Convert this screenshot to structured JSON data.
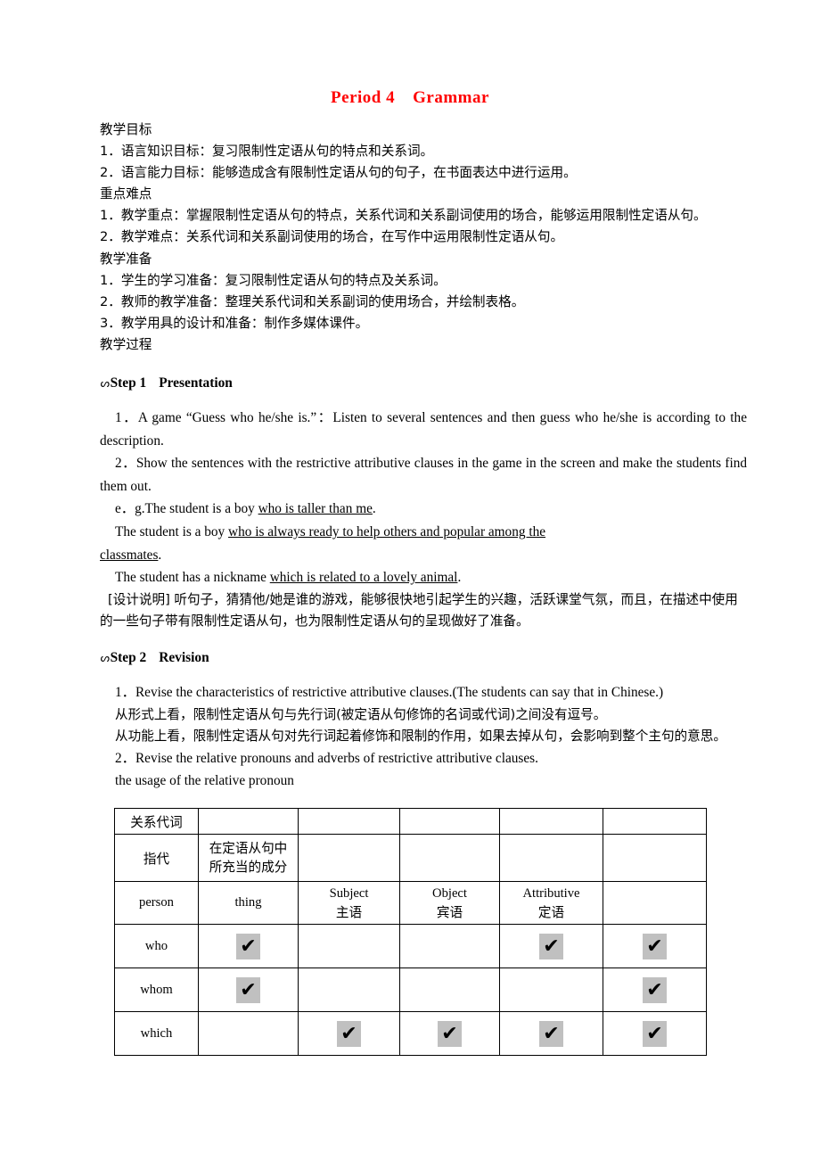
{
  "document": {
    "title_main": "Period 4",
    "title_sub": "Grammar",
    "title_color": "#ff0000"
  },
  "objectives": {
    "heading": "教学目标",
    "items": [
      "1．语言知识目标：复习限制性定语从句的特点和关系词。",
      "2．语言能力目标：能够造成含有限制性定语从句的句子，在书面表达中进行运用。"
    ]
  },
  "key_points": {
    "heading": "重点难点",
    "item1": "1．教学重点：掌握限制性定语从句的特点，关系代词和关系副词使用的场合，能够运用限制性定语从句。",
    "item2": "2．教学难点：关系代词和关系副词使用的场合，在写作中运用限制性定语从句。"
  },
  "preparation": {
    "heading": "教学准备",
    "items": [
      "1．学生的学习准备：复习限制性定语从句的特点及关系词。",
      "2．教师的教学准备：整理关系代词和关系副词的使用场合，并绘制表格。",
      "3．教学用具的设计和准备：制作多媒体课件。"
    ]
  },
  "process": {
    "heading": "教学过程"
  },
  "step1": {
    "bullet": "wingding-bullet-icon",
    "label": "Step 1",
    "name": "Presentation",
    "item1": "1．A game “Guess who he/she is.”：Listen to several sentences  and then guess who he/she is according to the description.",
    "item2": "2．Show the sentences with the restrictive attributive clauses in the game in the screen and make the students find them out.",
    "example1_prefix": "e．g.The student is a boy ",
    "example1_underline": "who  is  taller  than  me",
    "example1_suffix": ".",
    "example2_prefix": "The student is a boy ",
    "example2_underline": "who  is  always  ready  to  help  others  and  popular  among  the ",
    "example2_underline_cont": "classmates",
    "example2_suffix": ".",
    "example3_prefix": "The student has a nickname ",
    "example3_underline": "which  is  related  to  a  lovely  animal",
    "example3_suffix": ".",
    "design_note": "[设计说明] 听句子，猜猜他/她是谁的游戏，能够很快地引起学生的兴趣，活跃课堂气氛，而且，在描述中使用的一些句子带有限制性定语从句，也为限制性定语从句的呈现做好了准备。"
  },
  "step2": {
    "bullet": "wingding-bullet-icon",
    "label": "Step 2",
    "name": "Revision",
    "item1": "1．Revise the characteristics of restrictive attributive clauses.(The students can say that in Chinese.)",
    "note1": "从形式上看，限制性定语从句与先行词(被定语从句修饰的名词或代词)之间没有逗号。",
    "note2": "从功能上看，限制性定语从句对先行词起着修饰和限制的作用，如果去掉从句，会影响到整个主句的意思。",
    "item2": "2．Revise the relative pronouns and adverbs of restrictive attributive clauses.",
    "table_caption": "the usage of the relative pronoun"
  },
  "table": {
    "header_label": "关系代词",
    "row_zhidai": {
      "c1": "指代",
      "c2_line1": "在定语从句中",
      "c2_line2": "所充当的成分"
    },
    "row_subheader": {
      "c1": "person",
      "c2": "thing",
      "c3_en": "Subject",
      "c3_cn": "主语",
      "c4_en": "Object",
      "c4_cn": "宾语",
      "c5_en": "Attributive",
      "c5_cn": "定语",
      "c6": ""
    },
    "check_glyph": "✔",
    "check_bg": "#c0c0c0",
    "rows": [
      {
        "label": "who",
        "cells": [
          true,
          false,
          false,
          true,
          true,
          false
        ]
      },
      {
        "label": "whom",
        "cells": [
          true,
          false,
          false,
          false,
          true,
          false
        ]
      },
      {
        "label": "which",
        "cells": [
          false,
          true,
          true,
          true,
          true,
          false
        ]
      }
    ]
  }
}
